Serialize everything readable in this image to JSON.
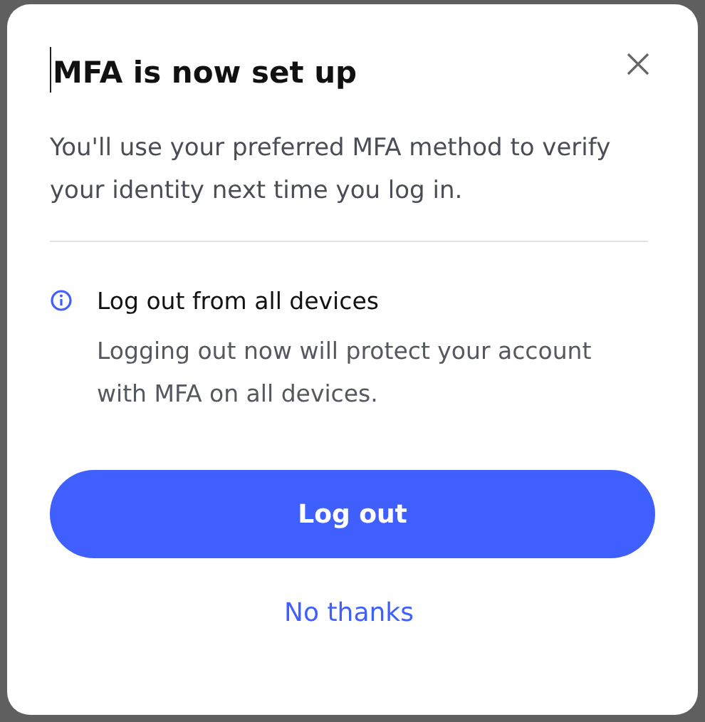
{
  "dialog": {
    "title": "MFA is now set up",
    "message": "You'll use your preferred MFA method to verify your identity next time you log in.",
    "notice": {
      "heading": "Log out from all devices",
      "text": "Logging out now will protect your account with MFA on all devices."
    },
    "buttons": [
      {
        "kind": "primary",
        "label": "Log out"
      },
      {
        "kind": "link",
        "label": "No thanks"
      }
    ]
  }
}
